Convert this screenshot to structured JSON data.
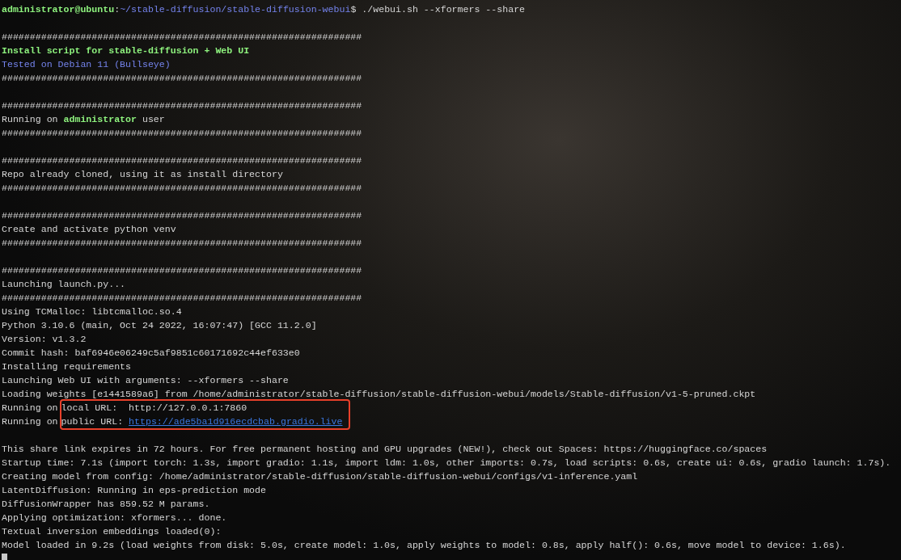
{
  "terminal": {
    "lines": [
      {
        "kind": "prompt",
        "segments": [
          {
            "kind": "user",
            "text": "administrator@ubuntu"
          },
          {
            "kind": "plain",
            "text": ":"
          },
          {
            "kind": "path",
            "text": "~/stable-diffusion/stable-diffusion-webui"
          },
          {
            "kind": "plain",
            "text": "$ ./webui.sh --xformers --share"
          }
        ]
      },
      {
        "kind": "blank"
      },
      {
        "kind": "rule",
        "text": "################################################################"
      },
      {
        "kind": "heading",
        "text": "Install script for stable-diffusion + Web UI"
      },
      {
        "kind": "info",
        "text": "Tested on Debian 11 (Bullseye)"
      },
      {
        "kind": "rule",
        "text": "################################################################"
      },
      {
        "kind": "blank"
      },
      {
        "kind": "rule",
        "text": "################################################################"
      },
      {
        "kind": "text",
        "text": "Running on **administrator** user"
      },
      {
        "kind": "rule",
        "text": "################################################################"
      },
      {
        "kind": "blank"
      },
      {
        "kind": "rule",
        "text": "################################################################"
      },
      {
        "kind": "text",
        "text": "Repo already cloned, using it as install directory"
      },
      {
        "kind": "rule",
        "text": "################################################################"
      },
      {
        "kind": "blank"
      },
      {
        "kind": "rule",
        "text": "################################################################"
      },
      {
        "kind": "text",
        "text": "Create and activate python venv"
      },
      {
        "kind": "rule",
        "text": "################################################################"
      },
      {
        "kind": "blank"
      },
      {
        "kind": "rule",
        "text": "################################################################"
      },
      {
        "kind": "text",
        "text": "Launching launch.py..."
      },
      {
        "kind": "rule",
        "text": "################################################################"
      },
      {
        "kind": "text",
        "text": "Using TCMalloc: libtcmalloc.so.4"
      },
      {
        "kind": "text",
        "text": "Python 3.10.6 (main, Oct 24 2022, 16:07:47) [GCC 11.2.0]"
      },
      {
        "kind": "text",
        "text": "Version: v1.3.2"
      },
      {
        "kind": "text",
        "text": "Commit hash: baf6946e06249c5af9851c60171692c44ef633e0"
      },
      {
        "kind": "text",
        "text": "Installing requirements"
      },
      {
        "kind": "text",
        "text": "Launching Web UI with arguments: --xformers --share"
      },
      {
        "kind": "text",
        "text": "Loading weights [e1441589a6] from /home/administrator/stable-diffusion/stable-diffusion-webui/models/Stable-diffusion/v1-5-pruned.ckpt"
      },
      {
        "kind": "highlighted",
        "prefixes": [
          "Running on",
          "Running on"
        ],
        "rows": [
          [
            {
              "kind": "plain",
              "text": "local URL:  http://127.0.0.1:7860"
            }
          ],
          [
            {
              "kind": "plain",
              "text": "public URL: "
            },
            {
              "kind": "link",
              "text": "https://ade5ba1d916ecdcbab.gradio.live"
            }
          ]
        ]
      },
      {
        "kind": "blank"
      },
      {
        "kind": "text",
        "text": "This share link expires in 72 hours. For free permanent hosting and GPU upgrades (NEW!), check out Spaces: https://huggingface.co/spaces"
      },
      {
        "kind": "text",
        "text": "Startup time: 7.1s (import torch: 1.3s, import gradio: 1.1s, import ldm: 1.0s, other imports: 0.7s, load scripts: 0.6s, create ui: 0.6s, gradio launch: 1.7s)."
      },
      {
        "kind": "text",
        "text": "Creating model from config: /home/administrator/stable-diffusion/stable-diffusion-webui/configs/v1-inference.yaml"
      },
      {
        "kind": "text",
        "text": "LatentDiffusion: Running in eps-prediction mode"
      },
      {
        "kind": "text",
        "text": "DiffusionWrapper has 859.52 M params."
      },
      {
        "kind": "text",
        "text": "Applying optimization: xformers... done."
      },
      {
        "kind": "text",
        "text": "Textual inversion embeddings loaded(0):"
      },
      {
        "kind": "text",
        "text": "Model loaded in 9.2s (load weights from disk: 5.0s, create model: 1.0s, apply weights to model: 0.8s, apply half(): 0.6s, move model to device: 1.6s)."
      },
      {
        "kind": "cursor"
      }
    ]
  }
}
